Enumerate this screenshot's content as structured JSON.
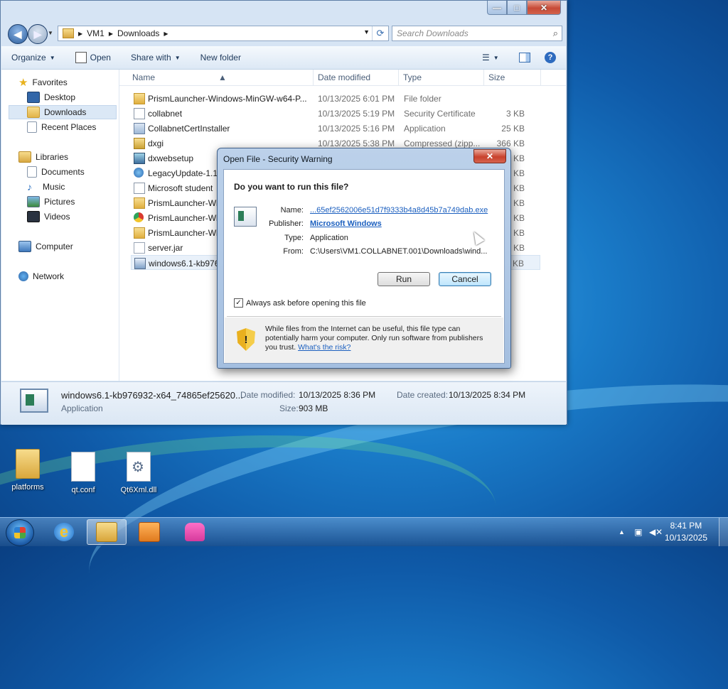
{
  "explorer": {
    "address": {
      "segments": [
        "VM1",
        "Downloads"
      ]
    },
    "search": {
      "placeholder": "Search Downloads"
    },
    "toolbar": {
      "organize": "Organize",
      "open": "Open",
      "share_with": "Share with",
      "new_folder": "New folder"
    },
    "nav": {
      "favorites": "Favorites",
      "desktop": "Desktop",
      "downloads": "Downloads",
      "recent_places": "Recent Places",
      "libraries": "Libraries",
      "documents": "Documents",
      "music": "Music",
      "pictures": "Pictures",
      "videos": "Videos",
      "computer": "Computer",
      "network": "Network"
    },
    "columns": {
      "name": "Name",
      "date": "Date modified",
      "type": "Type",
      "size": "Size"
    },
    "files": [
      {
        "name": "PrismLauncher-Windows-MinGW-w64-P...",
        "date": "10/13/2025 6:01 PM",
        "type": "File folder",
        "size": "",
        "icon": "folder-icon"
      },
      {
        "name": "collabnet",
        "date": "10/13/2025 5:19 PM",
        "type": "Security Certificate",
        "size": "3 KB",
        "icon": "certificate-icon"
      },
      {
        "name": "CollabnetCertInstaller",
        "date": "10/13/2025 5:16 PM",
        "type": "Application",
        "size": "25 KB",
        "icon": "application-icon"
      },
      {
        "name": "dxgi",
        "date": "10/13/2025 5:38 PM",
        "type": "Compressed (zipp...",
        "size": "366 KB",
        "icon": "zip-icon"
      },
      {
        "name": "dxwebsetup",
        "date": "",
        "type": "",
        "size": "289 KB",
        "icon": "setup-icon"
      },
      {
        "name": "LegacyUpdate-1.12",
        "date": "",
        "type": "",
        "size": "533 KB",
        "icon": "globe-icon"
      },
      {
        "name": "Microsoft student",
        "date": "",
        "type": "",
        "size": "716 KB",
        "icon": "document-icon"
      },
      {
        "name": "PrismLauncher-Wi",
        "date": "",
        "type": "",
        "size": "383 KB",
        "icon": "folder-icon"
      },
      {
        "name": "PrismLauncher-Wi",
        "date": "",
        "type": "",
        "size": "529 KB",
        "icon": "chrome-icon"
      },
      {
        "name": "PrismLauncher-Wi",
        "date": "",
        "type": "",
        "size": "256 KB",
        "icon": "folder-icon"
      },
      {
        "name": "server.jar",
        "date": "",
        "type": "",
        "size": "614 KB",
        "icon": "jar-icon"
      },
      {
        "name": "windows6.1-kb976",
        "date": "",
        "type": "",
        "size": "374 KB",
        "icon": "msu-icon"
      }
    ],
    "details": {
      "file_name": "windows6.1-kb976932-x64_74865ef25620...",
      "file_type": "Application",
      "modified_label": "Date modified:",
      "modified_value": "10/13/2025 8:36 PM",
      "created_label": "Date created:",
      "created_value": "10/13/2025 8:34 PM",
      "size_label": "Size:",
      "size_value": "903 MB"
    }
  },
  "dialog": {
    "title": "Open File - Security Warning",
    "question": "Do you want to run this file?",
    "name_label": "Name:",
    "name_value": "...65ef2562006e51d7f9333b4a8d45b7a749dab.exe",
    "publisher_label": "Publisher:",
    "publisher_value": "Microsoft Windows",
    "type_label": "Type:",
    "type_value": "Application",
    "from_label": "From:",
    "from_value": "C:\\Users\\VM1.COLLABNET.001\\Downloads\\wind...",
    "run": "Run",
    "cancel": "Cancel",
    "always_ask": "Always ask before opening this file",
    "warning_text": "While files from the Internet can be useful, this file type can potentially harm your computer. Only run software from publishers you trust. ",
    "risk_link": "What's the risk?"
  },
  "desktop": {
    "icons": [
      {
        "label": "platforms"
      },
      {
        "label": "qt.conf"
      },
      {
        "label": "Qt6Xml.dll"
      }
    ]
  },
  "taskbar": {
    "time": "8:41 PM",
    "date": "10/13/2025"
  }
}
